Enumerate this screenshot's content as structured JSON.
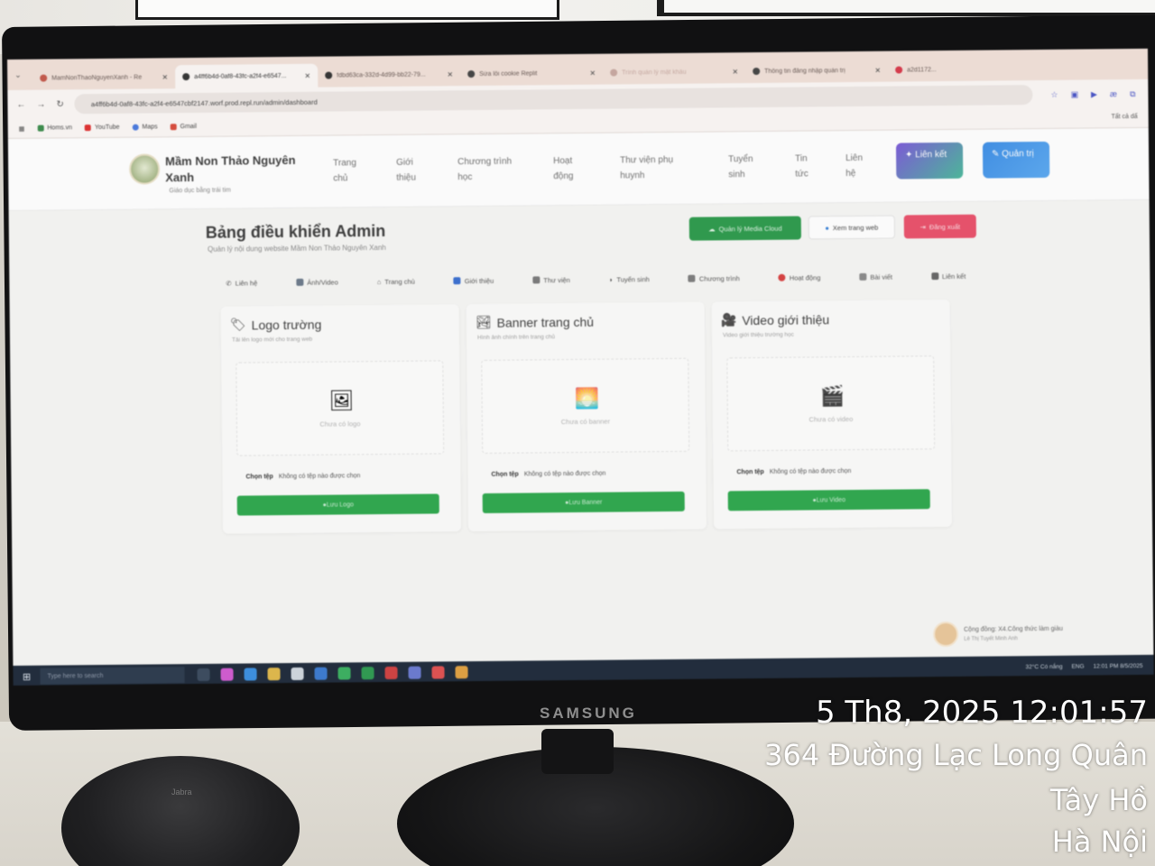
{
  "browser": {
    "tabs": [
      {
        "label": "MamNonThaoNguyenXanh - Re"
      },
      {
        "label": "a4ff6b4d-0af8-43fc-a2f4-e6547..."
      },
      {
        "label": "fdbd63ca-332d-4d99-bb22-79..."
      },
      {
        "label": "Sửa lỗi cookie Replit"
      },
      {
        "label": "Trình quản lý mật khẩu"
      },
      {
        "label": "Thông tin đăng nhập quản trị"
      },
      {
        "label": "a2d1172..."
      }
    ],
    "url": "a4ff6b4d-0af8-43fc-a2f4-e6547cbf2147.worf.prod.repl.run/admin/dashboard",
    "bookmarks": [
      "Homs.vn",
      "YouTube",
      "Maps",
      "Gmail"
    ],
    "all_bookmarks": "Tất cả dấ"
  },
  "site": {
    "school_name": "Mầm Non Thảo Nguyên Xanh",
    "tagline": "Giáo dục bằng trái tim",
    "menu": [
      "Trang chủ",
      "Giới thiệu",
      "Chương trình học",
      "Hoạt động",
      "Thư viện phụ huynh",
      "Tuyển sinh",
      "Tin tức",
      "Liên hệ"
    ],
    "btn_links": "Liên kết",
    "btn_admin": "Quản trị"
  },
  "admin": {
    "title": "Bảng điều khiển Admin",
    "subtitle": "Quản lý nội dung website Mầm Non Thảo Nguyên Xanh",
    "btn_manage_media": "Quản lý Media Cloud",
    "btn_view_site": "Xem trang web",
    "btn_logout": "Đăng xuất",
    "tabs": [
      "Liên hệ",
      "Ảnh/Video",
      "Trang chủ",
      "Giới thiệu",
      "Thư viện",
      "Tuyển sinh",
      "Chương trình",
      "Hoạt động",
      "Bài viết",
      "Liên kết"
    ],
    "cards": [
      {
        "title": "Logo trường",
        "subtitle": "Tải lên logo mới cho trang web",
        "empty": "Chưa có logo",
        "choose": "Chọn tệp",
        "no_file": "Không có tệp nào được chọn",
        "upload": "Lưu Logo"
      },
      {
        "title": "Banner trang chủ",
        "subtitle": "Hình ảnh chính trên trang chủ",
        "empty": "Chưa có banner",
        "choose": "Chọn tệp",
        "no_file": "Không có tệp nào được chọn",
        "upload": "Lưu Banner"
      },
      {
        "title": "Video giới thiệu",
        "subtitle": "Video giới thiệu trường học",
        "empty": "Chưa có video",
        "choose": "Chọn tệp",
        "no_file": "Không có tệp nào được chọn",
        "upload": "Lưu Video"
      }
    ],
    "toast": {
      "line1": "Cộng đồng: X4.Công thức làm giàu",
      "line2": "Lê Thị Tuyết Minh Anh"
    }
  },
  "taskbar": {
    "search_placeholder": "Type here to search",
    "weather": "32°C Có nắng",
    "lang": "ENG",
    "time": "12:01 PM",
    "date": "8/5/2025"
  },
  "photo_stamp": {
    "datetime": "5 Th8, 2025 12:01:57",
    "address": "364 Đường Lạc Long Quân",
    "district": "Tây Hồ",
    "city": "Hà Nội"
  },
  "monitor_brand": "SAMSUNG",
  "speaker_brand": "Jabra"
}
